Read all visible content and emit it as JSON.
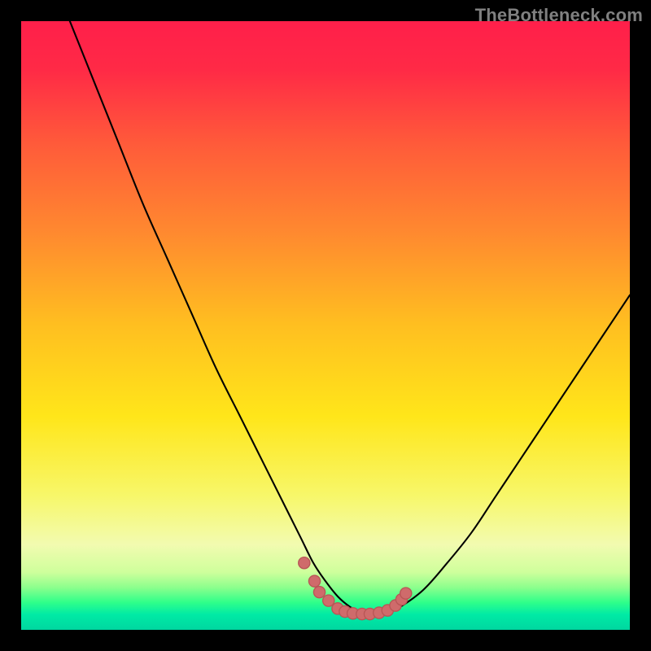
{
  "watermark": "TheBottleneck.com",
  "colors": {
    "frame": "#000000",
    "curve": "#000000",
    "dot_fill": "#cf6b6b",
    "dot_stroke": "#b85656",
    "gradient_stops": [
      {
        "offset": 0.0,
        "color": "#ff1f4a"
      },
      {
        "offset": 0.08,
        "color": "#ff2a46"
      },
      {
        "offset": 0.2,
        "color": "#ff5a3a"
      },
      {
        "offset": 0.35,
        "color": "#ff8a2f"
      },
      {
        "offset": 0.5,
        "color": "#ffbf20"
      },
      {
        "offset": 0.65,
        "color": "#ffe61a"
      },
      {
        "offset": 0.78,
        "color": "#f7f76a"
      },
      {
        "offset": 0.86,
        "color": "#f2fbb0"
      },
      {
        "offset": 0.905,
        "color": "#cfff9c"
      },
      {
        "offset": 0.93,
        "color": "#8dff8d"
      },
      {
        "offset": 0.955,
        "color": "#2fff8a"
      },
      {
        "offset": 0.975,
        "color": "#00eaa5"
      },
      {
        "offset": 1.0,
        "color": "#00d7a0"
      }
    ]
  },
  "chart_data": {
    "type": "line",
    "title": "",
    "xlabel": "",
    "ylabel": "",
    "xlim": [
      0,
      100
    ],
    "ylim": [
      0,
      100
    ],
    "grid": false,
    "series": [
      {
        "name": "bottleneck-curve",
        "x": [
          8,
          12,
          16,
          20,
          24,
          28,
          32,
          36,
          40,
          44,
          46,
          48,
          50,
          52,
          54,
          56,
          58,
          60,
          62,
          66,
          70,
          74,
          78,
          82,
          86,
          90,
          94,
          98,
          100
        ],
        "y": [
          100,
          90,
          80,
          70,
          61,
          52,
          43,
          35,
          27,
          19,
          15,
          11,
          8,
          5.5,
          3.8,
          2.8,
          2.5,
          2.8,
          3.6,
          6.5,
          11,
          16,
          22,
          28,
          34,
          40,
          46,
          52,
          55
        ]
      }
    ],
    "highlight_points": {
      "name": "highlighted-range",
      "x": [
        46.5,
        48.2,
        49.0,
        50.5,
        52.0,
        53.2,
        54.5,
        56.0,
        57.3,
        58.8,
        60.2,
        61.5,
        62.5,
        63.2
      ],
      "y": [
        11.0,
        8.0,
        6.2,
        4.8,
        3.5,
        3.0,
        2.7,
        2.6,
        2.6,
        2.8,
        3.2,
        4.0,
        5.0,
        6.0
      ]
    }
  }
}
